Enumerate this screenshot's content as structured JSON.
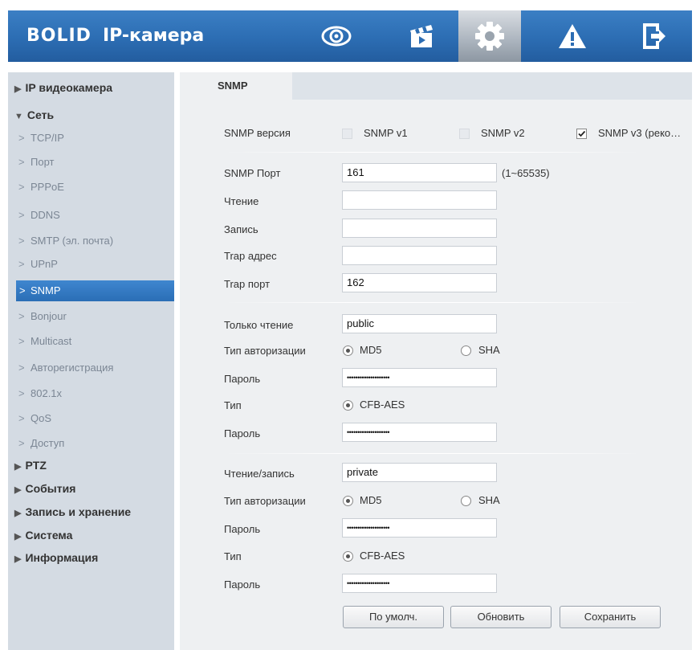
{
  "header": {
    "logo": "BOLID",
    "title": "IP-камера",
    "icons": [
      "eye-icon",
      "clapperboard-icon",
      "gear-icon",
      "warning-icon",
      "exit-icon"
    ],
    "accent": "#2c6db3"
  },
  "sidebar": {
    "top_items": [
      "IP видеокамера",
      "Сеть",
      "PTZ",
      "События",
      "Запись и хранение",
      "Система",
      "Информация"
    ],
    "network_items": [
      "TCP/IP",
      "Порт",
      "PPPoE",
      "DDNS",
      "SMTP (эл. почта)",
      "UPnP",
      "SNMP",
      "Bonjour",
      "Multicast",
      "Авторегистрация",
      "802.1x",
      "QoS",
      "Доступ"
    ],
    "active": "SNMP"
  },
  "tab": {
    "label": "SNMP"
  },
  "form": {
    "version_label": "SNMP версия",
    "v1": "SNMP v1",
    "v2": "SNMP v2",
    "v3": "SNMP v3 (реко…",
    "v1_checked": false,
    "v2_checked": false,
    "v3_checked": true,
    "port_label": "SNMP Порт",
    "port_value": "161",
    "port_hint": "(1~65535)",
    "read_label": "Чтение",
    "read_value": "",
    "write_label": "Запись",
    "write_value": "",
    "trap_addr_label": "Trap адрес",
    "trap_addr_value": "",
    "trap_port_label": "Trap порт",
    "trap_port_value": "162",
    "ro": {
      "label": "Только чтение",
      "value": "public",
      "auth_label": "Тип авторизации",
      "auth_md5": "MD5",
      "auth_sha": "SHA",
      "auth_selected": "MD5",
      "pass_label": "Пароль",
      "pass_value": "••••••••••••••••••••",
      "type_label": "Тип",
      "type_value": "CFB-AES",
      "pass2_label": "Пароль",
      "pass2_value": "••••••••••••••••••••"
    },
    "rw": {
      "label": "Чтение/запись",
      "value": "private",
      "auth_label": "Тип авторизации",
      "auth_md5": "MD5",
      "auth_sha": "SHA",
      "auth_selected": "MD5",
      "pass_label": "Пароль",
      "pass_value": "••••••••••••••••••••",
      "type_label": "Тип",
      "type_value": "CFB-AES",
      "pass2_label": "Пароль",
      "pass2_value": "••••••••••••••••••••"
    }
  },
  "buttons": {
    "default": "По умолч.",
    "refresh": "Обновить",
    "save": "Сохранить"
  }
}
